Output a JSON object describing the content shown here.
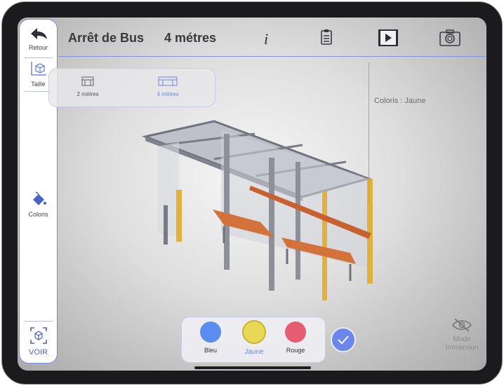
{
  "app": {
    "title": "Arrêt de Bus",
    "size_value": "4 métres"
  },
  "sidebar": {
    "back_label": "Retour",
    "size_label": "Taille",
    "color_label": "Coloris",
    "view_label": "VOIR"
  },
  "topbar": {
    "info_icon": "info-icon",
    "notes_icon": "clipboard-icon",
    "video_icon": "film-icon",
    "camera_icon": "camera-icon"
  },
  "size_options": [
    {
      "label": "2 métres",
      "active": false
    },
    {
      "label": "4 métres",
      "active": true
    }
  ],
  "color_info": "Coloris : Jaune",
  "colors": [
    {
      "label": "Bleu",
      "hex": "#5b8df0",
      "active": false
    },
    {
      "label": "Jaune",
      "hex": "#e8d856",
      "active": true
    },
    {
      "label": "Rouge",
      "hex": "#e65c70",
      "active": false
    }
  ],
  "immersion_label_1": "Mode",
  "immersion_label_2": "Immersion",
  "accent_color": "#6f86e0"
}
